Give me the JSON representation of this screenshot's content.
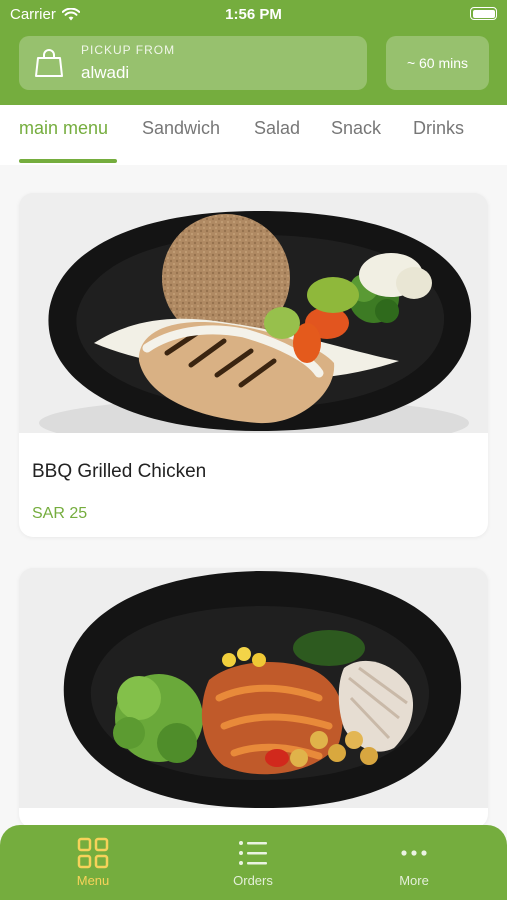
{
  "status_bar": {
    "carrier": "Carrier",
    "time": "1:56 PM"
  },
  "pickup": {
    "label": "PICKUP FROM",
    "value": "alwadi"
  },
  "estimate": {
    "label": "~ 60 mins"
  },
  "tabs": [
    {
      "label": "main menu",
      "active": true
    },
    {
      "label": "Sandwich",
      "active": false
    },
    {
      "label": "Salad",
      "active": false
    },
    {
      "label": "Snack",
      "active": false
    },
    {
      "label": "Drinks",
      "active": false
    }
  ],
  "products": [
    {
      "name": "BBQ Grilled Chicken",
      "price": "SAR 25",
      "image": "grilled-chicken-rice-bowl"
    },
    {
      "name": "",
      "price": "",
      "image": "salad-noodle-bowl"
    }
  ],
  "bottom_nav": [
    {
      "label": "Menu",
      "icon": "grid-icon",
      "active": true
    },
    {
      "label": "Orders",
      "icon": "list-icon",
      "active": false
    },
    {
      "label": "More",
      "icon": "more-icon",
      "active": false
    }
  ],
  "colors": {
    "brand": "#75ad3e",
    "active_nav": "#f6d25a",
    "price": "#75ad3e"
  }
}
